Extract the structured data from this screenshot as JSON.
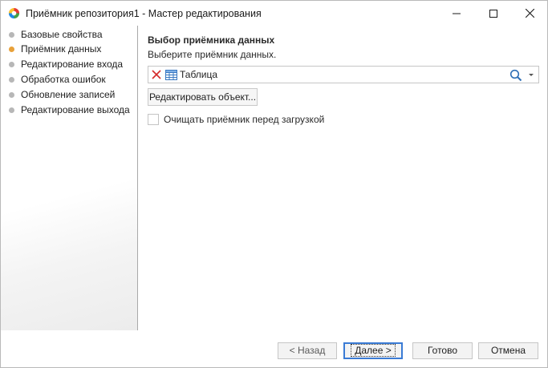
{
  "window": {
    "title": "Приёмник репозитория1 - Мастер редактирования",
    "controls": [
      "minimize-icon",
      "maximize-icon",
      "close-icon"
    ]
  },
  "nav": {
    "items": [
      {
        "label": "Базовые свойства",
        "active": false
      },
      {
        "label": "Приёмник данных",
        "active": true
      },
      {
        "label": "Редактирование входа",
        "active": false
      },
      {
        "label": "Обработка ошибок",
        "active": false
      },
      {
        "label": "Обновление записей",
        "active": false
      },
      {
        "label": "Редактирование выхода",
        "active": false
      }
    ]
  },
  "main": {
    "section_title": "Выбор приёмника данных",
    "section_desc": "Выберите приёмник данных.",
    "combo": {
      "value": "Таблица",
      "icons": [
        "clear-icon",
        "table-icon",
        "search-icon",
        "dropdown-arrow-icon"
      ]
    },
    "edit_button": "Редактировать объект...",
    "clear_checkbox": {
      "label": "Очищать приёмник перед загрузкой",
      "checked": false
    }
  },
  "footer": {
    "back": "< Назад",
    "next": "Далее >",
    "done": "Готово",
    "cancel": "Отмена"
  },
  "colors": {
    "active_dot": "#e8a13a",
    "inactive_dot": "#b7b7b7",
    "clear_icon": "#d42a2a",
    "focus_border": "#3a7bd5"
  }
}
